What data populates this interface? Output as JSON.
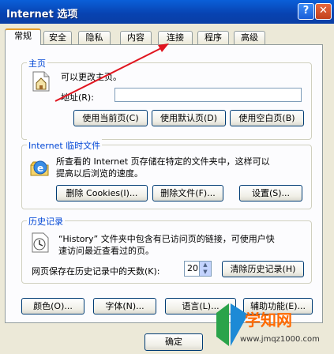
{
  "window": {
    "title": "Internet 选项",
    "help_label": "?",
    "close_label": "✕"
  },
  "tabs": [
    {
      "label": "常规",
      "active": true
    },
    {
      "label": "安全"
    },
    {
      "label": "隐私"
    },
    {
      "label": "内容"
    },
    {
      "label": "连接"
    },
    {
      "label": "程序"
    },
    {
      "label": "高级"
    }
  ],
  "homepage": {
    "title": "主页",
    "desc": "可以更改主页。",
    "address_label": "地址(R):",
    "address_value": "",
    "buttons": [
      "使用当前页(C)",
      "使用默认页(D)",
      "使用空白页(B)"
    ]
  },
  "temp_files": {
    "title": "Internet 临时文件",
    "desc_line1": "所查看的 Internet 页存储在特定的文件夹中，这样可以",
    "desc_line2": "提高以后浏览的速度。",
    "buttons": [
      "删除 Cookies(I)...",
      "删除文件(F)...",
      "设置(S)..."
    ]
  },
  "history": {
    "title": "历史记录",
    "desc_line1": "“History” 文件夹中包含有已访问页的链接，可使用户快",
    "desc_line2": "速访问最近查看过的页。",
    "days_label": "网页保存在历史记录中的天数(K):",
    "days_value": "20",
    "clear_button": "清除历史记录(H)"
  },
  "bottom_buttons": [
    "颜色(O)...",
    "字体(N)...",
    "语言(L)...",
    "辅助功能(E)..."
  ],
  "dialog_buttons": {
    "ok": "确定"
  },
  "watermark": {
    "site": "学知网",
    "url": "www.jmqz1000.com"
  },
  "colors": {
    "title_bar": "#0842b0",
    "group_title": "#0046d5",
    "annotation_arrow": "#e0141e"
  },
  "icons": {
    "homepage": "house-page-icon",
    "temp_files": "ie-globe-icon",
    "history": "history-clock-icon"
  }
}
